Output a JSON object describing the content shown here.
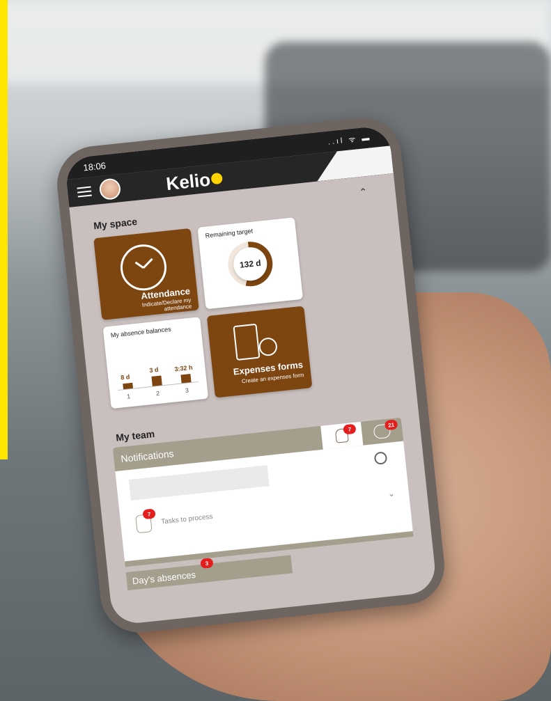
{
  "status_bar": {
    "time": "18:06",
    "icons": "..ıl ᯤ ▬"
  },
  "header": {
    "app_name": "Kelio",
    "logo_color": "#ffd200"
  },
  "my_space": {
    "title": "My space",
    "attendance": {
      "title": "Attendance",
      "subtitle": "Indicate/Declare my attendance"
    },
    "remaining_target": {
      "label": "Remaining target",
      "value": "132 d",
      "progress_fraction": 0.55
    },
    "absence_balances": {
      "label": "My absence balances",
      "bars": [
        {
          "category": "1",
          "value_label": "8 d"
        },
        {
          "category": "2",
          "value_label": "3 d"
        },
        {
          "category": "3",
          "value_label": "3:32 h"
        }
      ]
    },
    "expenses": {
      "title": "Expenses forms",
      "subtitle": "Create an expenses form"
    }
  },
  "my_team": {
    "title": "My team",
    "notifications_tab": "Notifications",
    "person_badge": "7",
    "group_badge": "21",
    "tasks": {
      "label": "Tasks to process",
      "badge": "7"
    },
    "days_absences": {
      "label": "Day's absences",
      "badge": "3"
    }
  },
  "colors": {
    "brand_brown": "#7d4510",
    "taupe": "#a49e8c",
    "badge_red": "#e41d1d",
    "accent_yellow": "#ffe600"
  }
}
